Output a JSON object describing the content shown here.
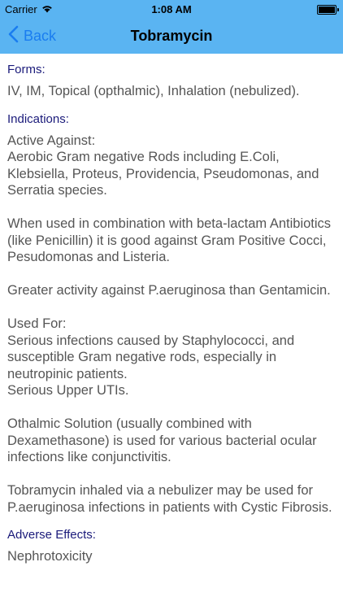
{
  "status_bar": {
    "carrier": "Carrier",
    "time": "1:08 AM",
    "battery_level_percent": 100
  },
  "nav": {
    "back_label": "Back",
    "title": "Tobramycin"
  },
  "sections": {
    "forms": {
      "header": "Forms:",
      "body": "IV, IM, Topical (opthalmic), Inhalation (nebulized)."
    },
    "indications": {
      "header": "Indications:",
      "paragraphs": [
        "Active Against:\nAerobic Gram negative Rods including E.Coli, Klebsiella, Proteus, Providencia, Pseudomonas, and Serratia species.",
        "When used in combination with beta-lactam Antibiotics (like Penicillin) it is good against Gram Positive Cocci, Pesudomonas and Listeria.",
        "Greater activity against P.aeruginosa than Gentamicin.",
        "Used For:\nSerious infections caused by Staphylococci, and susceptible Gram negative rods, especially in neutropinic patients.\nSerious Upper UTIs.",
        "Othalmic Solution (usually combined with Dexamethasone) is used for various bacterial ocular infections like conjunctivitis.",
        "Tobramycin inhaled via a nebulizer may be used for P.aeruginosa infections in patients with Cystic Fibrosis."
      ]
    },
    "adverse_effects": {
      "header": "Adverse Effects:",
      "body": "Nephrotoxicity"
    }
  }
}
